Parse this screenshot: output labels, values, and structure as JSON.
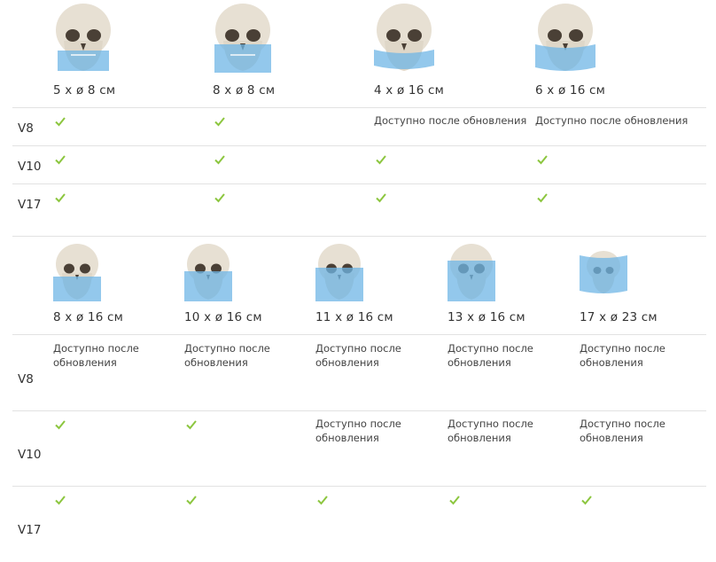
{
  "colors": {
    "check": "#8cc63f",
    "divider": "#e2e2e2",
    "fov": "#7fbfe8"
  },
  "icons": {
    "skull": "skull-fov-image",
    "check": "check-icon"
  },
  "table1": {
    "fovs": [
      "5 x ø 8 см",
      "8 x ø 8 см",
      "4 x ø 16 см",
      "6 x ø 16 см"
    ],
    "rows": [
      {
        "label": "V8",
        "cells": [
          "check",
          "check",
          "Доступно после обновления",
          "Доступно после обновления"
        ]
      },
      {
        "label": "V10",
        "cells": [
          "check",
          "check",
          "check",
          "check"
        ]
      },
      {
        "label": "V17",
        "cells": [
          "check",
          "check",
          "check",
          "check"
        ]
      }
    ]
  },
  "table2": {
    "fovs": [
      "8 x ø 16 см",
      "10 x ø 16 см",
      "11 x ø 16 см",
      "13 x ø 16 см",
      "17 x ø 23 см"
    ],
    "rows": [
      {
        "label": "V8",
        "cells": [
          "Доступно после обновления",
          "Доступно после обновления",
          "Доступно после обновления",
          "Доступно после обновления",
          "Доступно после обновления"
        ]
      },
      {
        "label": "V10",
        "cells": [
          "check",
          "check",
          "Доступно после обновления",
          "Доступно после обновления",
          "Доступно после обновления"
        ]
      },
      {
        "label": "V17",
        "cells": [
          "check",
          "check",
          "check",
          "check",
          "check"
        ]
      }
    ]
  }
}
